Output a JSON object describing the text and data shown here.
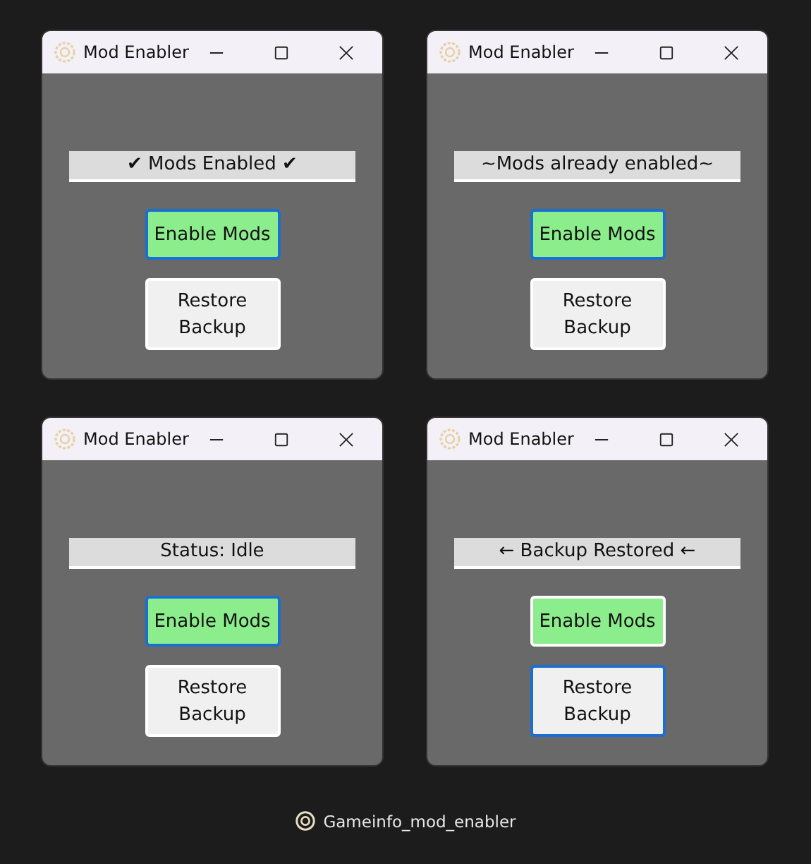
{
  "windows": [
    {
      "title": "Mod Enabler",
      "status": "✔ Mods Enabled ✔",
      "buttons": [
        {
          "label": "Enable Mods",
          "kind": "enable",
          "focused": true
        },
        {
          "label": "Restore Backup",
          "kind": "restore",
          "focused": false
        }
      ]
    },
    {
      "title": "Mod Enabler",
      "status": "~Mods already enabled~",
      "buttons": [
        {
          "label": "Enable Mods",
          "kind": "enable",
          "focused": true
        },
        {
          "label": "Restore Backup",
          "kind": "restore",
          "focused": false
        }
      ]
    },
    {
      "title": "Mod Enabler",
      "status": "Status: Idle",
      "buttons": [
        {
          "label": "Enable Mods",
          "kind": "enable",
          "focused": true
        },
        {
          "label": "Restore Backup",
          "kind": "restore",
          "focused": false
        }
      ]
    },
    {
      "title": "Mod Enabler",
      "status": "← Backup Restored ←",
      "buttons": [
        {
          "label": "Enable Mods",
          "kind": "enable",
          "focused": false
        },
        {
          "label": "Restore Backup",
          "kind": "restore",
          "focused": true
        }
      ]
    }
  ],
  "caption": "Gameinfo_mod_enabler"
}
